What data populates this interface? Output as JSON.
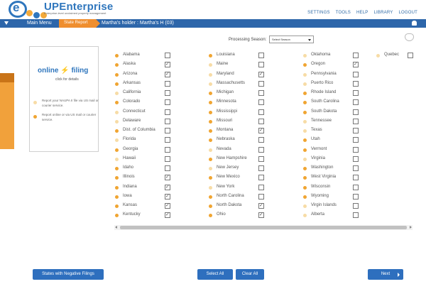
{
  "brand": {
    "title": "UPEnterprise",
    "tagline": "Enterprise-level unclaimed property management"
  },
  "topnav": [
    "SETTINGS",
    "TOOLS",
    "HELP",
    "LIBRARY",
    "LOGOUT"
  ],
  "breadcrumb": {
    "main_menu": "Main Menu",
    "state_report": "State Report",
    "holder": "Martha's holder : Martha's H (03)"
  },
  "processing": {
    "label": "Processing Season:",
    "select_placeholder": "Select Season"
  },
  "online_panel": {
    "title_a": "online",
    "title_b": "filing",
    "click": "click for details",
    "option1": "Report your NAUPA II file via US mail or courier service.",
    "option2": "Report online or via US mail or courier service."
  },
  "states": [
    [
      {
        "name": "Alabama",
        "dot": "#f0a532",
        "checked": false
      },
      {
        "name": "Alaska",
        "dot": "#f0a532",
        "checked": true
      },
      {
        "name": "Arizona",
        "dot": "#f0a532",
        "checked": true
      },
      {
        "name": "Arkansas",
        "dot": "#f0a532",
        "checked": false
      },
      {
        "name": "California",
        "dot": "#f7dca6",
        "checked": false
      },
      {
        "name": "Colorado",
        "dot": "#f0a532",
        "checked": false
      },
      {
        "name": "Connecticut",
        "dot": "#f7dca6",
        "checked": false
      },
      {
        "name": "Delaware",
        "dot": "#f7dca6",
        "checked": false
      },
      {
        "name": "Dist. of Columbia",
        "dot": "#f0a532",
        "checked": false
      },
      {
        "name": "Florida",
        "dot": "#f7dca6",
        "checked": false
      },
      {
        "name": "Georgia",
        "dot": "#f0a532",
        "checked": false
      },
      {
        "name": "Hawaii",
        "dot": "#f7dca6",
        "checked": false
      },
      {
        "name": "Idaho",
        "dot": "#f0a532",
        "checked": false
      },
      {
        "name": "Illinois",
        "dot": "#f0a532",
        "checked": true
      },
      {
        "name": "Indiana",
        "dot": "#f0a532",
        "checked": true
      },
      {
        "name": "Iowa",
        "dot": "#f0a532",
        "checked": true
      },
      {
        "name": "Kansas",
        "dot": "#f0a532",
        "checked": true
      },
      {
        "name": "Kentucky",
        "dot": "#f0a532",
        "checked": true
      }
    ],
    [
      {
        "name": "Louisiana",
        "dot": "#f0a532",
        "checked": false
      },
      {
        "name": "Maine",
        "dot": "#f7dca6",
        "checked": false
      },
      {
        "name": "Maryland",
        "dot": "#f7dca6",
        "checked": true
      },
      {
        "name": "Massachusetts",
        "dot": "#f7dca6",
        "checked": false
      },
      {
        "name": "Michigan",
        "dot": "#f0a532",
        "checked": false
      },
      {
        "name": "Minnesota",
        "dot": "#f0a532",
        "checked": false
      },
      {
        "name": "Mississippi",
        "dot": "#f0a532",
        "checked": false
      },
      {
        "name": "Missouri",
        "dot": "#f0a532",
        "checked": false
      },
      {
        "name": "Montana",
        "dot": "#f0a532",
        "checked": true
      },
      {
        "name": "Nebraska",
        "dot": "#f0a532",
        "checked": false
      },
      {
        "name": "Nevada",
        "dot": "#f7dca6",
        "checked": false
      },
      {
        "name": "New Hampshire",
        "dot": "#f0a532",
        "checked": false
      },
      {
        "name": "New Jersey",
        "dot": "#f7dca6",
        "checked": false
      },
      {
        "name": "New Mexico",
        "dot": "#f0a532",
        "checked": false
      },
      {
        "name": "New York",
        "dot": "#f7dca6",
        "checked": false
      },
      {
        "name": "North Carolina",
        "dot": "#f0a532",
        "checked": false
      },
      {
        "name": "North Dakota",
        "dot": "#f0a532",
        "checked": true
      },
      {
        "name": "Ohio",
        "dot": "#f0a532",
        "checked": true
      }
    ],
    [
      {
        "name": "Oklahoma",
        "dot": "#f7dca6",
        "checked": false
      },
      {
        "name": "Oregon",
        "dot": "#f0a532",
        "checked": true
      },
      {
        "name": "Pennsylvania",
        "dot": "#f7dca6",
        "checked": false
      },
      {
        "name": "Puerto Rico",
        "dot": "#f7dca6",
        "checked": false
      },
      {
        "name": "Rhode Island",
        "dot": "#f0a532",
        "checked": false
      },
      {
        "name": "South Carolina",
        "dot": "#f0a532",
        "checked": false
      },
      {
        "name": "South Dakota",
        "dot": "#f0a532",
        "checked": false
      },
      {
        "name": "Tennessee",
        "dot": "#f7dca6",
        "checked": false
      },
      {
        "name": "Texas",
        "dot": "#f7dca6",
        "checked": false
      },
      {
        "name": "Utah",
        "dot": "#f0a532",
        "checked": false
      },
      {
        "name": "Vermont",
        "dot": "#f0a532",
        "checked": false
      },
      {
        "name": "Virginia",
        "dot": "#f7dca6",
        "checked": false
      },
      {
        "name": "Washington",
        "dot": "#f0a532",
        "checked": false
      },
      {
        "name": "West Virginia",
        "dot": "#f0a532",
        "checked": false
      },
      {
        "name": "Wisconsin",
        "dot": "#f0a532",
        "checked": false
      },
      {
        "name": "Wyoming",
        "dot": "#f0a532",
        "checked": false
      },
      {
        "name": "Virgin Islands",
        "dot": "#f7dca6",
        "checked": false
      },
      {
        "name": "Alberta",
        "dot": "#f7dca6",
        "checked": false
      }
    ],
    [
      {
        "name": "Quebec",
        "dot": "#f7dca6",
        "checked": false
      }
    ]
  ],
  "buttons": {
    "negative_filings": "States with Negative Filings",
    "select_all": "Select All",
    "clear_all": "Clear All",
    "next": "Next"
  },
  "colors": {
    "primary_blue": "#2d66aa",
    "accent_orange": "#ef8e2e",
    "dot_online": "#f0a532",
    "dot_mail": "#f7dca6"
  }
}
